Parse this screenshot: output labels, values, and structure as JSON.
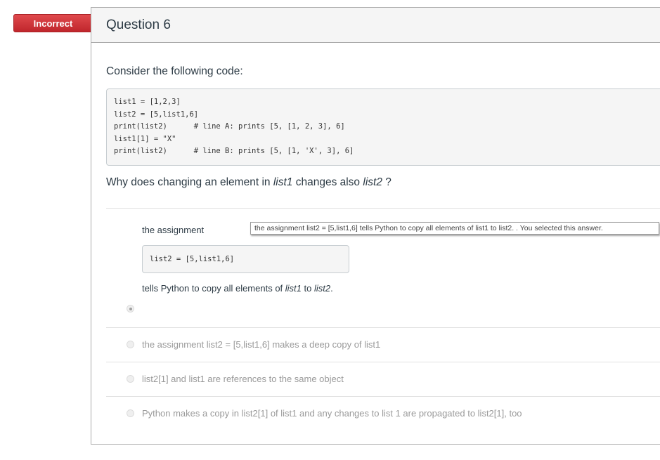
{
  "badge": {
    "label": "Incorrect",
    "color": "#d0312f"
  },
  "question": {
    "title": "Question 6",
    "intro": "Consider the following code:",
    "code_lines": [
      "list1 = [1,2,3]",
      "list2 = [5,list1,6]",
      "print(list2)      # line A: prints [5, [1, 2, 3], 6]",
      "list1[1] = \"X\"",
      "print(list2)      # line B: prints [5, [1, 'X', 3], 6]"
    ],
    "prompt": {
      "part1": "Why does changing an element in ",
      "var1": "list1",
      "part2": " changes also ",
      "var2": "list2",
      "part3": " ?"
    }
  },
  "answers": [
    {
      "selected": true,
      "label": "the assignment",
      "code": "list2 = [5,list1,6]",
      "tail_part1": "tells Python to  copy all elements of ",
      "tail_var1": "list1",
      "tail_part2": " to ",
      "tail_var2": "list2",
      "tail_part3": ".",
      "tooltip": "the assignment  list2 = [5,list1,6] tells Python to  copy all elements of list1 to list2.  . You selected this answer."
    },
    {
      "selected": false,
      "text": "the assignment list2 = [5,list1,6] makes a deep copy of list1"
    },
    {
      "selected": false,
      "text": "list2[1] and list1 are references to the same object"
    },
    {
      "selected": false,
      "text": "Python makes a copy in list2[1] of list1 and any changes to list 1 are propagated to list2[1], too"
    }
  ]
}
